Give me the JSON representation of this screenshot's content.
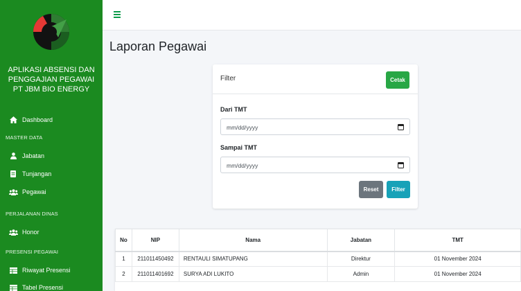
{
  "sidebar": {
    "brand_lines": [
      "APLIKASI ABSENSI DAN",
      "PENGGAJIAN PEGAWAI",
      "PT JBM BIO ENERGY"
    ],
    "dashboard": "Dashboard",
    "master_data_header": "MASTER DATA",
    "jabatan": "Jabatan",
    "tunjangan": "Tunjangan",
    "pegawai": "Pegawai",
    "perjalanan_header": "PERJALANAN DINAS",
    "honor": "Honor",
    "presensi_header": "PRESENSI PEGAWAI",
    "riwayat_presensi": "Riwayat Presensi",
    "tabel_presensi": "Tabel Presensi"
  },
  "page": {
    "title": "Laporan Pegawai"
  },
  "filter": {
    "title": "Filter",
    "cetak_label": "Cetak",
    "dari_label": "Dari TMT",
    "dari_placeholder": "mm/dd/yyyy",
    "sampai_label": "Sampai TMT",
    "sampai_placeholder": "mm/dd/yyyy",
    "reset_label": "Reset",
    "filter_label": "Filter"
  },
  "table": {
    "headers": [
      "No",
      "NIP",
      "Nama",
      "Jabatan",
      "TMT"
    ],
    "rows": [
      [
        "1",
        "211011450492",
        "RENTAULI SIMATUPANG",
        "Direktur",
        "01 November 2024"
      ],
      [
        "2",
        "211011401692",
        "SURYA ADI LUKITO",
        "Admin",
        "01 November 2024"
      ]
    ]
  },
  "colors": {
    "sidebar": "#1b8a20",
    "success": "#28a745",
    "info": "#17a2b8",
    "secondary": "#6c757d"
  }
}
